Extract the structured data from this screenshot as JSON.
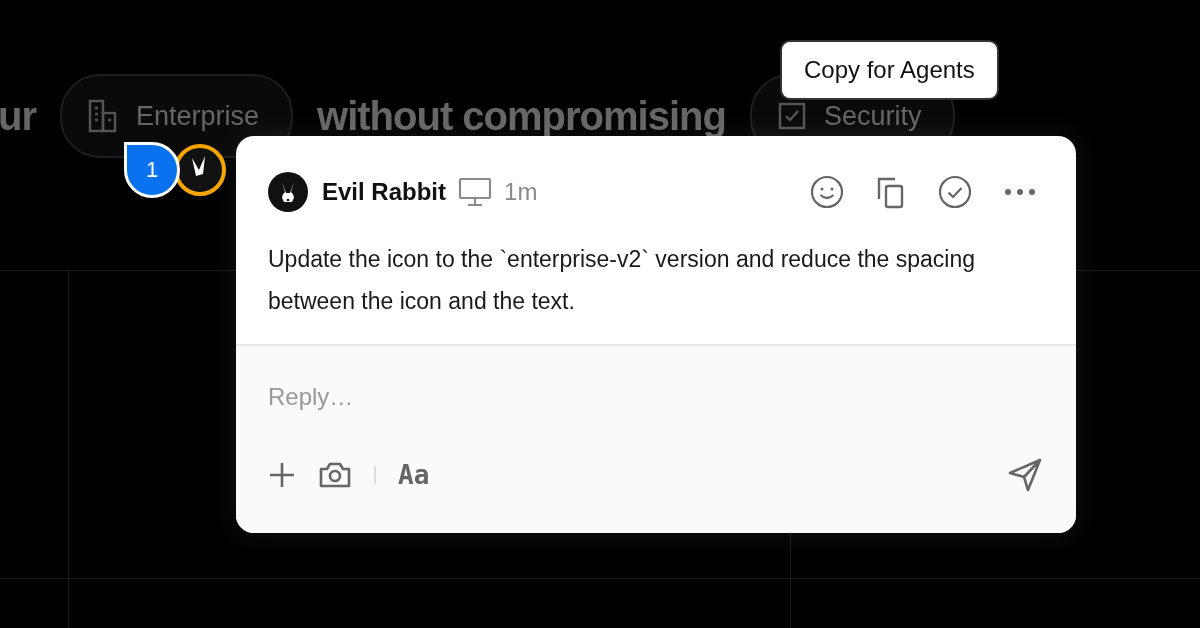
{
  "background": {
    "headline": [
      {
        "kind": "text",
        "text": "ur"
      },
      {
        "kind": "pill",
        "label": "Enterprise"
      },
      {
        "kind": "text",
        "text": "without compromising"
      },
      {
        "kind": "pill",
        "label": "Security"
      }
    ]
  },
  "marker": {
    "number": "1"
  },
  "tooltip": {
    "text": "Copy for Agents"
  },
  "comment": {
    "author": "Evil Rabbit",
    "time": "1m",
    "actions": [
      {
        "kind": "emoji"
      },
      {
        "kind": "copy"
      },
      {
        "kind": "resolve"
      },
      {
        "kind": "more"
      }
    ],
    "body": "Update the icon to the `enterprise-v2` version and reduce the spacing between the icon and the text."
  },
  "reply": {
    "placeholder": "Reply…",
    "tools": [
      {
        "kind": "add"
      },
      {
        "kind": "camera"
      },
      {
        "kind": "divider"
      },
      {
        "kind": "format",
        "label": "Aa"
      }
    ]
  }
}
